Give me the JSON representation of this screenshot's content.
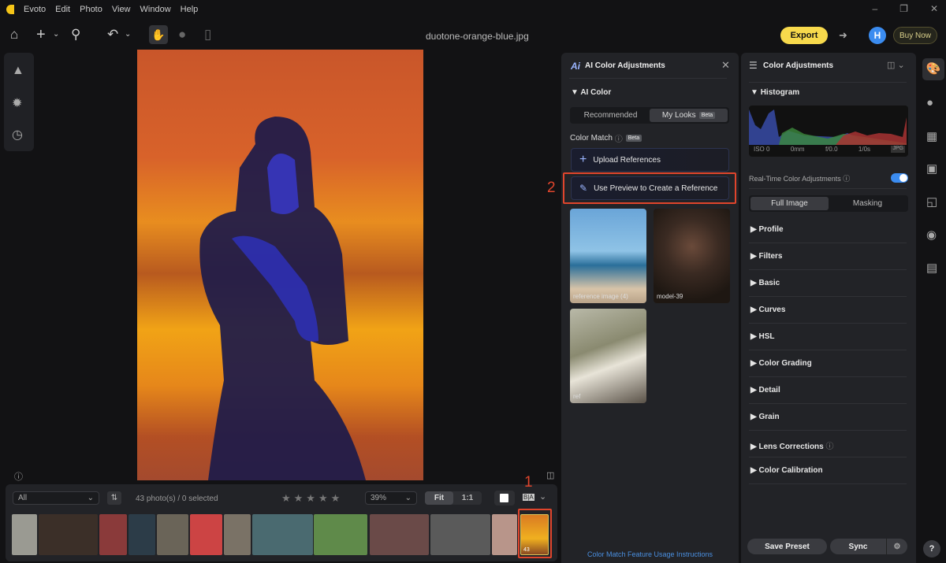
{
  "menu": {
    "app": "Evoto",
    "items": [
      "Edit",
      "Photo",
      "View",
      "Window",
      "Help"
    ]
  },
  "toolbar": {
    "filename": "duotone-orange-blue.jpg",
    "export": "Export",
    "avatar": "H",
    "buy_now": "Buy Now"
  },
  "filmstrip": {
    "filter": "All",
    "count": "43 photo(s) / 0 selected",
    "zoom": "39%",
    "fit": "Fit",
    "one_to_one": "1:1",
    "compare": "B|A",
    "selected_index": "43",
    "thumb_colors": [
      "#9a9a92",
      "#3b2f28",
      "#8a3a3a",
      "#2c3c48",
      "#6a6458",
      "#c44",
      "#7a7266",
      "#4a6a70",
      "#5f8a4a",
      "#6a4a48",
      "#5a5a5a",
      "#b8958a",
      "#d99a2a"
    ]
  },
  "ai_panel": {
    "title": "AI Color Adjustments",
    "section": "AI Color",
    "tabs": [
      "Recommended",
      "My Looks"
    ],
    "tab_badge": "Beta",
    "active_tab": 1,
    "color_match": "Color Match",
    "color_match_badge": "Beta",
    "upload": "Upload References",
    "use_preview": "Use Preview to Create a Reference",
    "references": [
      {
        "label": "reference image (4)"
      },
      {
        "label": "model-39"
      },
      {
        "label": "ref"
      }
    ],
    "footer_link": "Color Match Feature Usage Instructions"
  },
  "annotations": {
    "one": "1",
    "two": "2"
  },
  "right_panel": {
    "title": "Color Adjustments",
    "histogram": "Histogram",
    "exif": [
      "ISO 0",
      "0mm",
      "f/0.0",
      "1/0s",
      "JPG"
    ],
    "realtime": "Real-Time Color Adjustments",
    "realtime_on": true,
    "tabs": [
      "Full Image",
      "Masking"
    ],
    "sections": [
      "Profile",
      "Filters",
      "Basic",
      "Curves",
      "HSL",
      "Color Grading",
      "Detail",
      "Grain",
      "Lens Corrections",
      "Color Calibration"
    ],
    "save_preset": "Save Preset",
    "sync": "Sync"
  },
  "colors": {
    "accent": "#f7d94c",
    "toggle": "#3b8cf0",
    "annotation": "#e0452c",
    "link": "#4a8fe0"
  }
}
